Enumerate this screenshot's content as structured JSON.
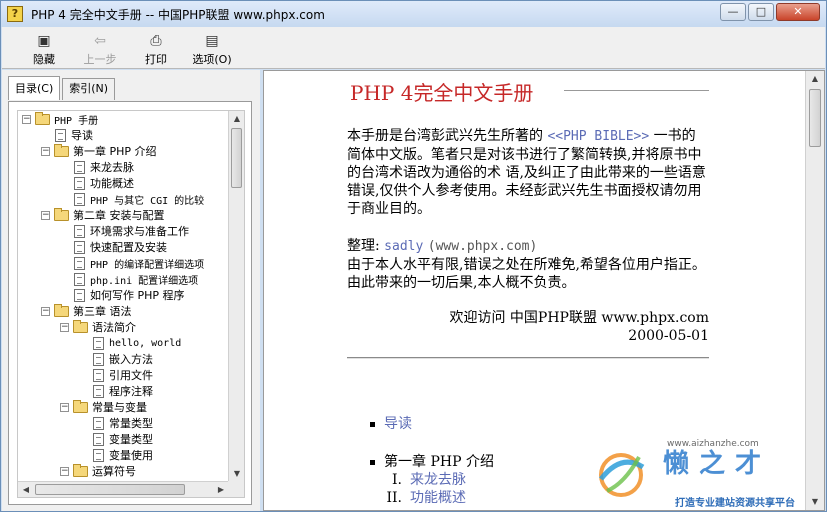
{
  "window": {
    "title": "PHP 4 完全中文手册 -- 中国PHP联盟 www.phpx.com",
    "app_icon": "?",
    "controls": {
      "minimize": "—",
      "maximize": "□",
      "close": "✕"
    }
  },
  "toolbar": {
    "hide_label": "隐藏",
    "back_label": "上一步",
    "print_label": "打印",
    "options_label": "选项(O)",
    "icons": {
      "hide": "hide-pane-icon",
      "back": "back-arrow-icon",
      "print": "printer-icon",
      "options": "options-icon"
    }
  },
  "left_pane": {
    "tabs": [
      {
        "label": "目录(C)",
        "active": true
      },
      {
        "label": "索引(N)",
        "active": false
      }
    ],
    "tree": [
      {
        "label": "PHP 手册",
        "type": "folder",
        "indent": 0,
        "expander": "⊟"
      },
      {
        "label": "导读",
        "type": "page",
        "indent": 1
      },
      {
        "label": "第一章  PHP 介绍",
        "type": "folder",
        "indent": 1,
        "expander": "⊟"
      },
      {
        "label": "来龙去脉",
        "type": "page",
        "indent": 2
      },
      {
        "label": "功能概述",
        "type": "page",
        "indent": 2
      },
      {
        "label": "PHP 与其它 CGI 的比较",
        "type": "page",
        "indent": 2
      },
      {
        "label": "第二章  安装与配置",
        "type": "folder",
        "indent": 1,
        "expander": "⊟"
      },
      {
        "label": "环境需求与准备工作",
        "type": "page",
        "indent": 2
      },
      {
        "label": "快速配置及安装",
        "type": "page",
        "indent": 2
      },
      {
        "label": "PHP 的编译配置详细选项",
        "type": "page",
        "indent": 2
      },
      {
        "label": "php.ini 配置详细选项",
        "type": "page",
        "indent": 2
      },
      {
        "label": "如何写作 PHP 程序",
        "type": "page",
        "indent": 2
      },
      {
        "label": "第三章  语法",
        "type": "folder",
        "indent": 1,
        "expander": "⊟"
      },
      {
        "label": "语法简介",
        "type": "folder",
        "indent": 2,
        "expander": "⊟"
      },
      {
        "label": "hello, world",
        "type": "page",
        "indent": 3
      },
      {
        "label": "嵌入方法",
        "type": "page",
        "indent": 3
      },
      {
        "label": "引用文件",
        "type": "page",
        "indent": 3
      },
      {
        "label": "程序注释",
        "type": "page",
        "indent": 3
      },
      {
        "label": "常量与变量",
        "type": "folder",
        "indent": 2,
        "expander": "⊟"
      },
      {
        "label": "常量类型",
        "type": "page",
        "indent": 3
      },
      {
        "label": "变量类型",
        "type": "page",
        "indent": 3
      },
      {
        "label": "变量使用",
        "type": "page",
        "indent": 3
      },
      {
        "label": "运算符号",
        "type": "folder",
        "indent": 2,
        "expander": "⊟"
      }
    ]
  },
  "content": {
    "title": "PHP 4完全中文手册",
    "intro_before": "本手册是台湾彭武兴先生所著的 ",
    "intro_link": "<<PHP BIBLE>>",
    "intro_after": " 一书的简体中文版。笔者只是对该书进行了繁简转换,并将原书中的台湾术语改为通俗的术 语,及纠正了由此带来的一些语意错误,仅供个人参考使用。未经彭武兴先生书面授权请勿用于商业目的。",
    "editor_label": "整理: ",
    "editor_name": "sadly",
    "editor_site": "(www.phpx.com)",
    "disclaimer": "由于本人水平有限,错误之处在所难免,希望各位用户指正。由此带来的一切后果,本人概不负责。",
    "visit_line": "欢迎访问 中国PHP联盟 www.phpx.com",
    "date": "2000-05-01",
    "toc": [
      {
        "label": "导读",
        "link": true
      },
      {
        "label": "第一章    PHP 介绍",
        "link": false,
        "children": [
          {
            "numeral": "I.",
            "label": "来龙去脉"
          },
          {
            "numeral": "II.",
            "label": "功能概述"
          }
        ]
      }
    ]
  },
  "watermark": {
    "url": "www.aizhanzhe.com",
    "name": "懒之才",
    "slogan": "打造专业建站资源共享平台"
  },
  "colors": {
    "title_red": "#c62828",
    "link_blue": "#5b6bb5",
    "watermark_blue": "#4c8fd4"
  }
}
